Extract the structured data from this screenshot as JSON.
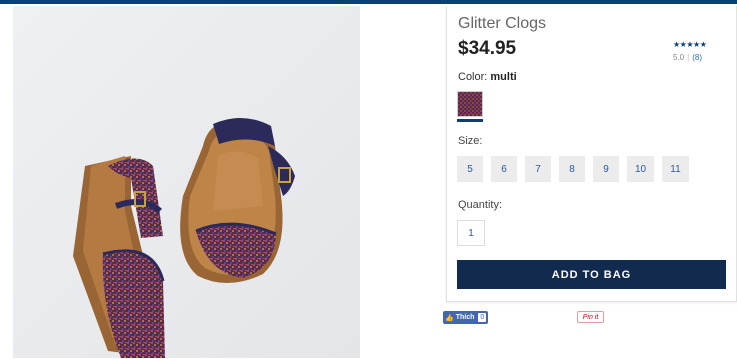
{
  "product": {
    "title": "Glitter Clogs",
    "price": "$34.95",
    "rating": {
      "stars": "★★★★★",
      "score": "5.0",
      "separator": "|",
      "count": "(8)"
    },
    "color": {
      "label": "Color:",
      "value": "multi"
    },
    "size": {
      "label": "Size:",
      "options": [
        "5",
        "6",
        "7",
        "8",
        "9",
        "10",
        "11"
      ]
    },
    "quantity": {
      "label": "Quantity:",
      "value": "1"
    },
    "add_to_bag_label": "ADD TO BAG"
  },
  "social": {
    "facebook": {
      "label": "Thích",
      "count": "0"
    },
    "pinterest": {
      "label": "Pin it"
    }
  },
  "colors": {
    "brand_navy": "#122a4d",
    "top_bar": "#0d3f76",
    "link_blue": "#2a6bb7"
  }
}
